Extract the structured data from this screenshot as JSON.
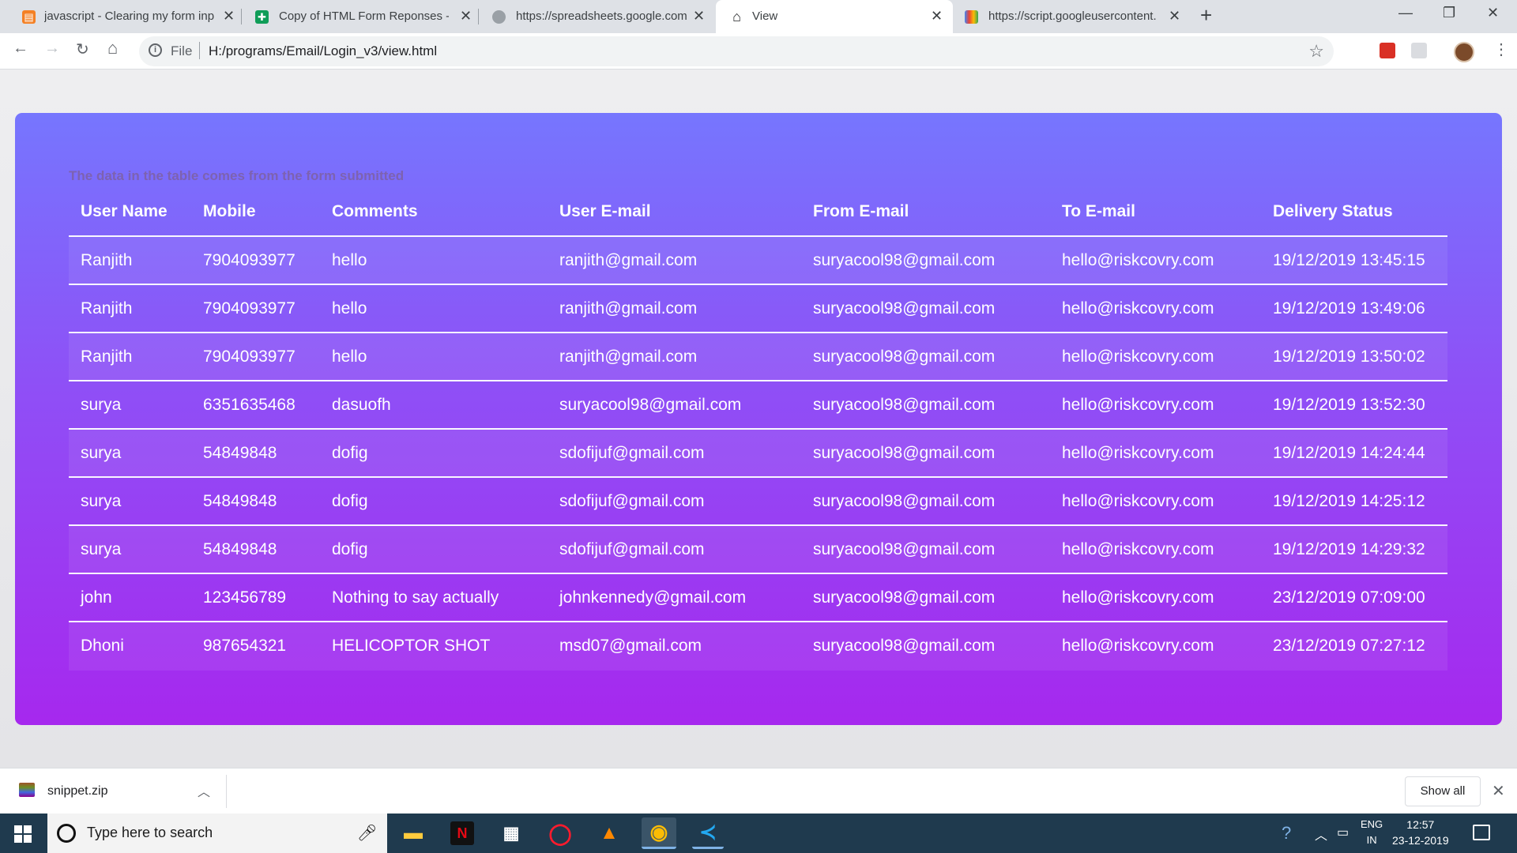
{
  "browser": {
    "tabs": [
      {
        "title": "javascript - Clearing my form inp",
        "active": false
      },
      {
        "title": "Copy of HTML Form Reponses - ",
        "active": false
      },
      {
        "title": "https://spreadsheets.google.com",
        "active": false
      },
      {
        "title": "View",
        "active": true
      },
      {
        "title": "https://script.googleusercontent.",
        "active": false
      }
    ],
    "new_tab_label": "+",
    "scheme_label": "File",
    "url": "H:/programs/Email/Login_v3/view.html"
  },
  "page": {
    "caption": "The data in the table comes from the form submitted",
    "columns": [
      "User Name",
      "Mobile",
      "Comments",
      "User E-mail",
      "From E-mail",
      "To E-mail",
      "Delivery Status"
    ],
    "rows": [
      [
        "Ranjith",
        "7904093977",
        "hello",
        "ranjith@gmail.com",
        "suryacool98@gmail.com",
        "hello@riskcovry.com",
        "19/12/2019 13:45:15"
      ],
      [
        "Ranjith",
        "7904093977",
        "hello",
        "ranjith@gmail.com",
        "suryacool98@gmail.com",
        "hello@riskcovry.com",
        "19/12/2019 13:49:06"
      ],
      [
        "Ranjith",
        "7904093977",
        "hello",
        "ranjith@gmail.com",
        "suryacool98@gmail.com",
        "hello@riskcovry.com",
        "19/12/2019 13:50:02"
      ],
      [
        "surya",
        "6351635468",
        "dasuofh",
        "suryacool98@gmail.com",
        "suryacool98@gmail.com",
        "hello@riskcovry.com",
        "19/12/2019 13:52:30"
      ],
      [
        "surya",
        "54849848",
        "dofig",
        "sdofijuf@gmail.com",
        "suryacool98@gmail.com",
        "hello@riskcovry.com",
        "19/12/2019 14:24:44"
      ],
      [
        "surya",
        "54849848",
        "dofig",
        "sdofijuf@gmail.com",
        "suryacool98@gmail.com",
        "hello@riskcovry.com",
        "19/12/2019 14:25:12"
      ],
      [
        "surya",
        "54849848",
        "dofig",
        "sdofijuf@gmail.com",
        "suryacool98@gmail.com",
        "hello@riskcovry.com",
        "19/12/2019 14:29:32"
      ],
      [
        "john",
        "123456789",
        "Nothing to say actually",
        "johnkennedy@gmail.com",
        "suryacool98@gmail.com",
        "hello@riskcovry.com",
        "23/12/2019 07:09:00"
      ],
      [
        "Dhoni",
        "987654321",
        "HELICOPTOR SHOT",
        "msd07@gmail.com",
        "suryacool98@gmail.com",
        "hello@riskcovry.com",
        "23/12/2019 07:27:12"
      ]
    ]
  },
  "downloads": {
    "file_name": "snippet.zip",
    "show_all_label": "Show all"
  },
  "taskbar": {
    "search_placeholder": "Type here to search",
    "lang_top": "ENG",
    "lang_bottom": "IN",
    "time": "12:57",
    "date": "23-12-2019"
  },
  "colors": {
    "card_top": "#7676fe",
    "card_bottom": "#a628ee",
    "taskbar": "#1f3a4e"
  }
}
